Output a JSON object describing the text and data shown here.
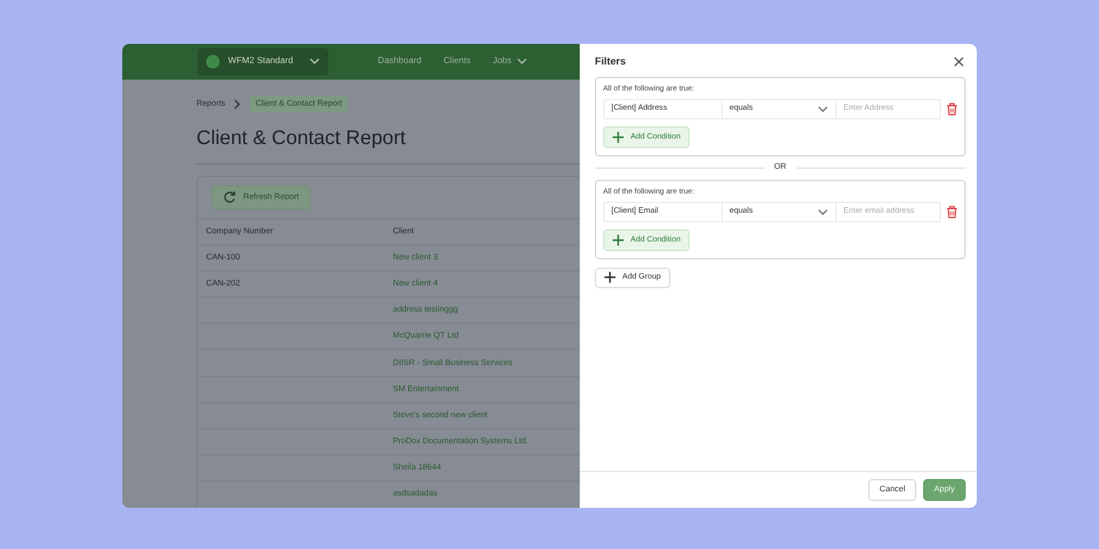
{
  "app": {
    "workspace": "WFM2 Standard",
    "nav": [
      {
        "label": "Dashboard",
        "dropdown": false
      },
      {
        "label": "Clients",
        "dropdown": false
      },
      {
        "label": "Jobs",
        "dropdown": true
      }
    ],
    "breadcrumbs": [
      {
        "label": "Reports",
        "current": false
      },
      {
        "label": "Client & Contact Report",
        "current": true
      }
    ],
    "title": "Client & Contact Report",
    "refresh_button": "Refresh Report",
    "table": {
      "columns": [
        "Company Number",
        "Client"
      ],
      "rows": [
        [
          "CAN-100",
          "New client 3"
        ],
        [
          "CAN-202",
          "New client 4"
        ],
        [
          "",
          "address testinggg"
        ],
        [
          "",
          "McQuarrie QT Ltd"
        ],
        [
          "",
          "DIISR - Small Business Services"
        ],
        [
          "",
          "SM Entertainment"
        ],
        [
          "",
          "Steve's second new client"
        ],
        [
          "",
          "ProDox Documentation Systems Ltd."
        ],
        [
          "",
          "Sheila 18644"
        ],
        [
          "",
          "asdsadadas"
        ]
      ]
    }
  },
  "filters": {
    "title": "Filters",
    "groups": [
      {
        "heading": "All of the following are true:",
        "conditions": [
          {
            "field": "[Client] Address",
            "operator": "equals",
            "placeholder": "Enter Address"
          }
        ],
        "add_button": "Add Condition"
      },
      {
        "heading": "All of the following are true:",
        "conditions": [
          {
            "field": "[Client] Email",
            "operator": "equals",
            "placeholder": "Enter email address"
          }
        ],
        "add_button": "Add Condition"
      }
    ],
    "separator": "OR",
    "add_group": "Add Group",
    "buttons": [
      {
        "label": "Cancel",
        "kind": "secondary"
      },
      {
        "label": "Apply",
        "kind": "primary"
      }
    ]
  }
}
